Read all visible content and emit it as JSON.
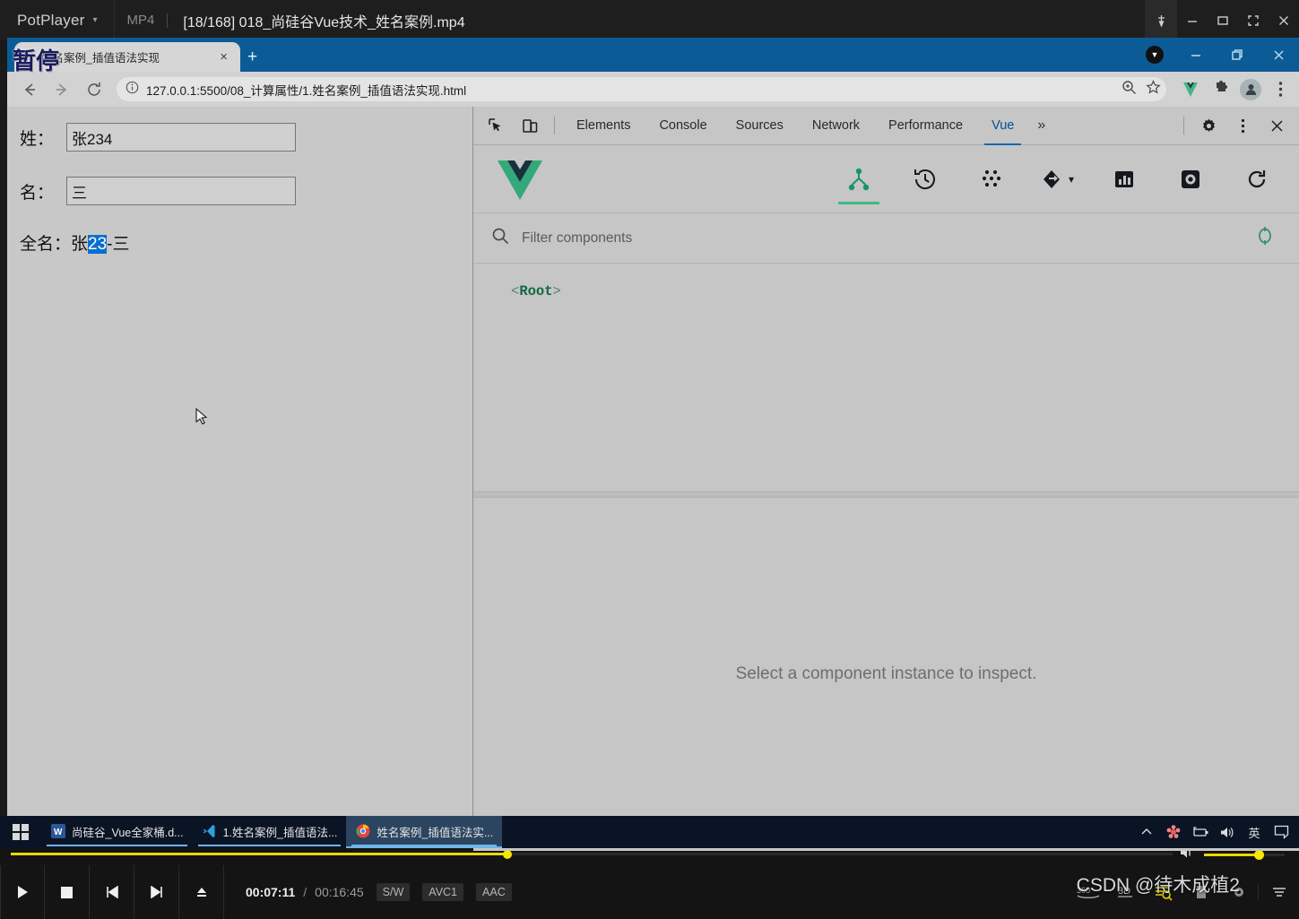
{
  "potplayer": {
    "app_name": "PotPlayer",
    "caret": "⌄",
    "format": "MP4",
    "file_title": "[18/168] 018_尚硅谷Vue技术_姓名案例.mp4",
    "pause_overlay": "暂停",
    "window_buttons": [
      "pin-icon",
      "minimize-icon",
      "maximize-icon",
      "fullscreen-icon",
      "close-icon"
    ],
    "controls": {
      "buttons": [
        "play-icon",
        "stop-icon",
        "previous-icon",
        "next-icon",
        "eject-icon"
      ],
      "current_time": "00:07:11",
      "separator": "/",
      "total_time": "00:16:45",
      "chips": [
        "S/W",
        "AVC1",
        "AAC"
      ],
      "right_tools": [
        "360",
        "3D",
        "playlist-search-icon",
        "bookmark-icon",
        "settings-icon",
        "menu-icon"
      ],
      "seek_percent": 43,
      "volume_percent": 69,
      "accent_color": "#e8d900"
    },
    "watermark": "CSDN @待木成植2"
  },
  "chrome": {
    "tab": {
      "title": "姓名案例_插值语法实现",
      "close_label": "×",
      "new_tab_label": "+"
    },
    "window_controls": [
      "minimize-icon",
      "restore-icon",
      "close-icon"
    ],
    "toolbar": {
      "back": "back-icon",
      "forward": "forward-icon",
      "reload": "reload-icon",
      "site_info": "info-icon",
      "url": "127.0.0.1:5500/08_计算属性/1.姓名案例_插值语法实现.html",
      "zoom_icon": "zoom-icon",
      "bookmark_icon": "star-icon",
      "extensions": [
        "vue-devtools-icon",
        "puzzle-icon"
      ],
      "profile_icon": "person-icon",
      "menu_icon": "kebab-menu-icon"
    }
  },
  "page": {
    "fields": [
      {
        "label": "姓：",
        "value": "张234"
      },
      {
        "label": "名：",
        "value": "三"
      }
    ],
    "fullname_label": "全名：",
    "fullname_prefix": "张",
    "fullname_selected": "23",
    "fullname_suffix": "-三",
    "selection_color": "#0a6ed1",
    "background_color": "#c8c8c8"
  },
  "devtools": {
    "left_icons": [
      "inspect-element-icon",
      "device-toolbar-icon"
    ],
    "tabs": [
      {
        "label": "Elements",
        "active": false
      },
      {
        "label": "Console",
        "active": false
      },
      {
        "label": "Sources",
        "active": false
      },
      {
        "label": "Network",
        "active": false
      },
      {
        "label": "Performance",
        "active": false
      },
      {
        "label": "Vue",
        "active": true
      }
    ],
    "more_tabs": "»",
    "right_icons": [
      "gear-icon",
      "kebab-menu-icon",
      "close-icon"
    ],
    "vue_panel": {
      "logo": "vue-logo-icon",
      "tools": [
        {
          "name": "components-tree-icon",
          "active": true
        },
        {
          "name": "timeline-history-icon",
          "active": false
        },
        {
          "name": "vuex-icon",
          "active": false
        },
        {
          "name": "routes-icon",
          "active": false
        },
        {
          "name": "performance-icon",
          "active": false
        },
        {
          "name": "settings-icon",
          "active": false
        },
        {
          "name": "refresh-icon",
          "active": false
        }
      ],
      "filter_placeholder": "Filter components",
      "filter_value": "",
      "select_target_icon": "target-icon",
      "tree": [
        {
          "open": "<",
          "name": "Root",
          "close": ">"
        }
      ],
      "detail_message": "Select a component instance to inspect.",
      "accent_color": "#41b883"
    }
  },
  "taskbar": {
    "start_icon": "windows-start-icon",
    "items": [
      {
        "icon": "word-icon",
        "label": "尚硅谷_Vue全家桶.d...",
        "active": false,
        "running": true
      },
      {
        "icon": "vscode-icon",
        "label": "1.姓名案例_插值语法...",
        "active": false,
        "running": true
      },
      {
        "icon": "chrome-icon",
        "label": "姓名案例_插值语法实...",
        "active": true,
        "running": true
      }
    ],
    "tray": [
      {
        "name": "show-hidden-icons",
        "glyph": "ⱏ"
      },
      {
        "name": "sogou-input-icon",
        "glyph": "✿"
      },
      {
        "name": "battery-icon",
        "glyph": ""
      },
      {
        "name": "volume-icon",
        "glyph": ""
      },
      {
        "name": "ime-language-icon",
        "glyph": "英"
      },
      {
        "name": "action-center-icon",
        "glyph": ""
      }
    ]
  }
}
